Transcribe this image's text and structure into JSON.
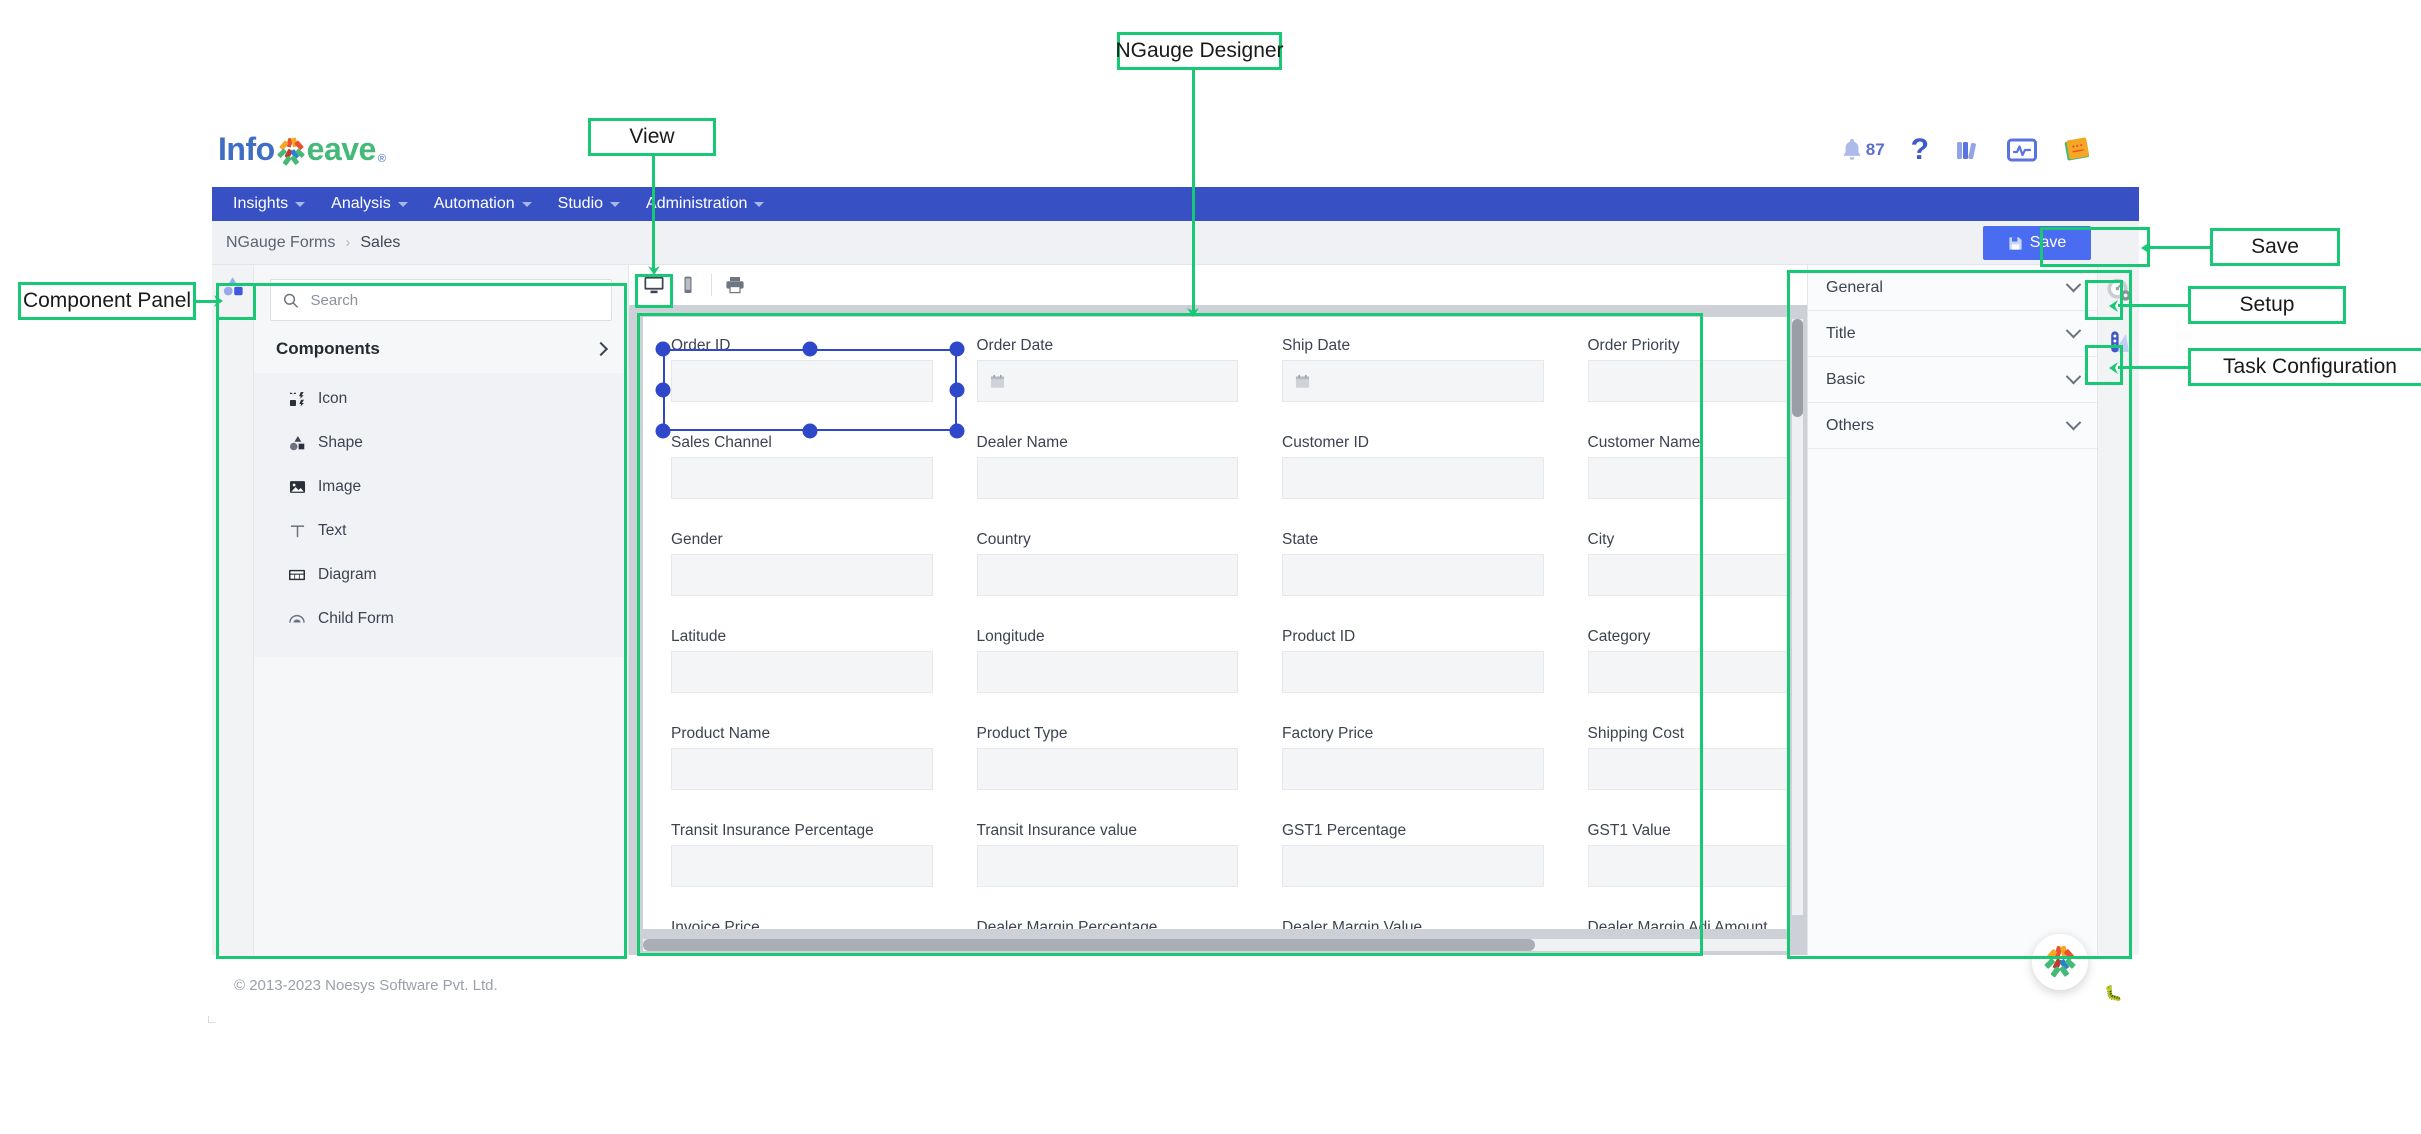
{
  "brand": {
    "name_part1": "Info",
    "name_part2": "eave",
    "registered": "®",
    "accent_blue": "#3750c4",
    "accent_green": "#46b97a",
    "save_blue": "#4a6cf0",
    "annotation_green": "#18c874"
  },
  "header": {
    "notification_count": "87",
    "icons": [
      {
        "name": "bell-icon",
        "label": "Notifications"
      },
      {
        "name": "help-icon",
        "label": "Help"
      },
      {
        "name": "library-icon",
        "label": "Library"
      },
      {
        "name": "monitor-icon",
        "label": "Monitor"
      },
      {
        "name": "notebook-icon",
        "label": "Notebook"
      }
    ]
  },
  "nav": {
    "items": [
      {
        "label": "Insights",
        "has_caret": true
      },
      {
        "label": "Analysis",
        "has_caret": true
      },
      {
        "label": "Automation",
        "has_caret": true
      },
      {
        "label": "Studio",
        "has_caret": true
      },
      {
        "label": "Administration",
        "has_caret": true
      }
    ]
  },
  "breadcrumb": {
    "root": "NGauge Forms",
    "separator": "›",
    "current": "Sales"
  },
  "toolbar": {
    "save_label": "Save"
  },
  "component_panel": {
    "search": {
      "placeholder": "Search",
      "value": ""
    },
    "section_title": "Components",
    "items": [
      {
        "label": "Icon",
        "icon": "icon-tool-icon"
      },
      {
        "label": "Shape",
        "icon": "shape-tool-icon"
      },
      {
        "label": "Image",
        "icon": "image-tool-icon"
      },
      {
        "label": "Text",
        "icon": "text-tool-icon"
      },
      {
        "label": "Diagram",
        "icon": "diagram-tool-icon"
      },
      {
        "label": "Child Form",
        "icon": "child-form-tool-icon"
      }
    ]
  },
  "view_toolbar": {
    "buttons": [
      {
        "name": "desktop-view-button",
        "label": "Desktop",
        "active": true
      },
      {
        "name": "mobile-view-button",
        "label": "Mobile",
        "active": false
      },
      {
        "name": "print-view-button",
        "label": "Print",
        "active": false
      }
    ]
  },
  "form": {
    "selected_field": "Order ID",
    "fields": [
      {
        "label": "Order ID",
        "type": "text",
        "selected": true
      },
      {
        "label": "Order Date",
        "type": "date",
        "selected": false
      },
      {
        "label": "Ship Date",
        "type": "date",
        "selected": false
      },
      {
        "label": "Order Priority",
        "type": "text",
        "selected": false
      },
      {
        "label": "Sales Channel",
        "type": "text",
        "selected": false
      },
      {
        "label": "Dealer Name",
        "type": "text",
        "selected": false
      },
      {
        "label": "Customer ID",
        "type": "text",
        "selected": false
      },
      {
        "label": "Customer Name",
        "type": "text",
        "selected": false
      },
      {
        "label": "Gender",
        "type": "text",
        "selected": false
      },
      {
        "label": "Country",
        "type": "text",
        "selected": false
      },
      {
        "label": "State",
        "type": "text",
        "selected": false
      },
      {
        "label": "City",
        "type": "text",
        "selected": false
      },
      {
        "label": "Latitude",
        "type": "text",
        "selected": false
      },
      {
        "label": "Longitude",
        "type": "text",
        "selected": false
      },
      {
        "label": "Product ID",
        "type": "text",
        "selected": false
      },
      {
        "label": "Category",
        "type": "text",
        "selected": false
      },
      {
        "label": "Product Name",
        "type": "text",
        "selected": false
      },
      {
        "label": "Product Type",
        "type": "text",
        "selected": false
      },
      {
        "label": "Factory Price",
        "type": "text",
        "selected": false
      },
      {
        "label": "Shipping Cost",
        "type": "text",
        "selected": false
      },
      {
        "label": "Transit Insurance Percentage",
        "type": "text",
        "selected": false
      },
      {
        "label": "Transit Insurance value",
        "type": "text",
        "selected": false
      },
      {
        "label": "GST1 Percentage",
        "type": "text",
        "selected": false
      },
      {
        "label": "GST1 Value",
        "type": "text",
        "selected": false
      },
      {
        "label": "Invoice Price",
        "type": "text",
        "selected": false
      },
      {
        "label": "Dealer Margin Percentage",
        "type": "text",
        "selected": false
      },
      {
        "label": "Dealer Margin Value",
        "type": "text",
        "selected": false
      },
      {
        "label": "Dealer Margin Adj Amount",
        "type": "text",
        "selected": false
      }
    ]
  },
  "properties_panel": {
    "sections": [
      {
        "label": "General"
      },
      {
        "label": "Title"
      },
      {
        "label": "Basic"
      },
      {
        "label": "Others"
      }
    ],
    "rail_buttons": [
      {
        "name": "setup-button",
        "label": "Setup"
      },
      {
        "name": "task-configuration-button",
        "label": "Task Configuration"
      }
    ]
  },
  "footer": {
    "copyright": "© 2013-2023 Noesys Software Pvt. Ltd."
  },
  "annotations": [
    {
      "id": "ngauge-designer",
      "label": "NGauge Designer"
    },
    {
      "id": "view",
      "label": "View"
    },
    {
      "id": "component-panel",
      "label": "Component  Panel"
    },
    {
      "id": "save",
      "label": "Save"
    },
    {
      "id": "setup",
      "label": "Setup"
    },
    {
      "id": "task-config",
      "label": "Task Configuration"
    }
  ]
}
